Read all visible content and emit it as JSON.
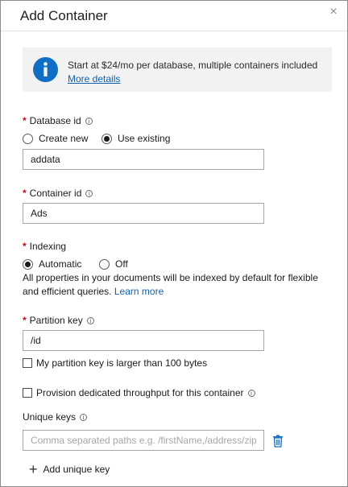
{
  "header": {
    "title": "Add Container",
    "close_glyph": "×"
  },
  "info": {
    "icon": "info-icon",
    "text": "Start at $24/mo per database, multiple containers included",
    "link": "More details"
  },
  "database_id": {
    "label": "Database id",
    "required": "*",
    "options": [
      "Create new",
      "Use existing"
    ],
    "selected": "Use existing",
    "value": "addata"
  },
  "container_id": {
    "label": "Container id",
    "required": "*",
    "value": "Ads"
  },
  "indexing": {
    "label": "Indexing",
    "required": "*",
    "options": [
      "Automatic",
      "Off"
    ],
    "selected": "Automatic",
    "description": "All properties in your documents will be indexed by default for flexible and efficient queries.",
    "learn_more": "Learn more"
  },
  "partition_key": {
    "label": "Partition key",
    "required": "*",
    "value": "/id",
    "large_key_label": "My partition key is larger than 100 bytes",
    "large_key_checked": false
  },
  "throughput": {
    "label": "Provision dedicated throughput for this container",
    "checked": false
  },
  "unique_keys": {
    "label": "Unique keys",
    "placeholder": "Comma separated paths e.g. /firstName,/address/zipCode",
    "add_label": "Add unique key"
  },
  "colors": {
    "accent": "#0f6fc6",
    "link": "#0f62b0",
    "required": "#d0021b"
  }
}
